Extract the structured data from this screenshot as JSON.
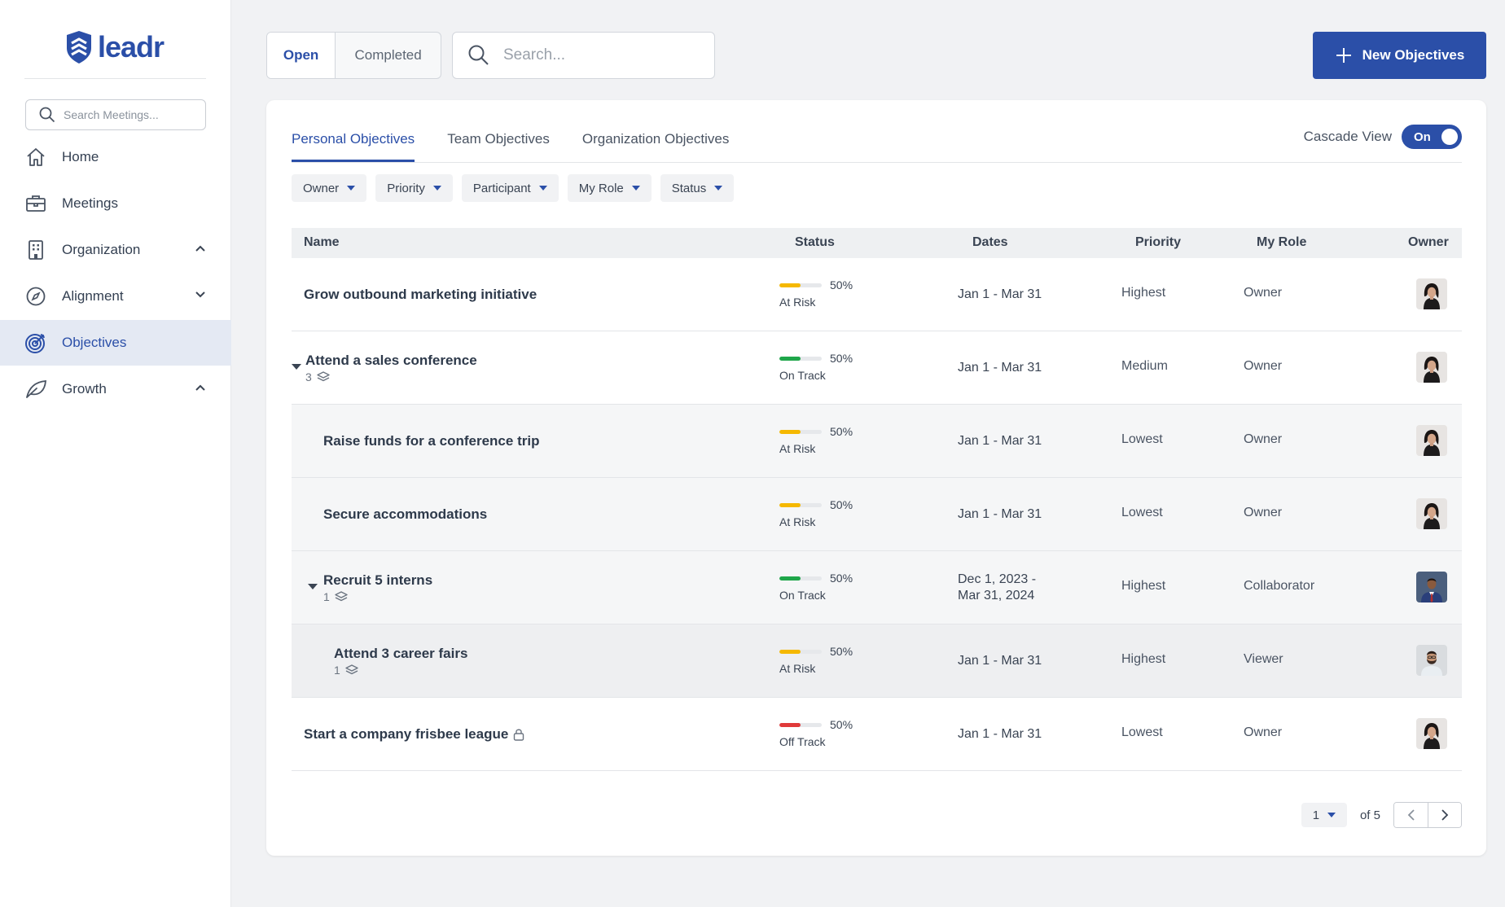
{
  "brand": {
    "name": "leadr",
    "color": "#2b4fa8"
  },
  "sidebar": {
    "search_placeholder": "Search Meetings...",
    "items": [
      {
        "label": "Home",
        "icon": "home-icon",
        "active": false
      },
      {
        "label": "Meetings",
        "icon": "briefcase-icon",
        "active": false
      },
      {
        "label": "Organization",
        "icon": "building-icon",
        "active": false,
        "chevron": "up"
      },
      {
        "label": "Alignment",
        "icon": "compass-icon",
        "active": false,
        "chevron": "down"
      },
      {
        "label": "Objectives",
        "icon": "target-icon",
        "active": true
      },
      {
        "label": "Growth",
        "icon": "leaf-icon",
        "active": false,
        "chevron": "up"
      }
    ]
  },
  "toolbar": {
    "segments": [
      "Open",
      "Completed"
    ],
    "active_segment": "Open",
    "search_placeholder": "Search...",
    "search_value": "",
    "new_button": "New Objectives"
  },
  "tabs": {
    "items": [
      "Personal Objectives",
      "Team Objectives",
      "Organization Objectives"
    ],
    "active": "Personal Objectives"
  },
  "cascade": {
    "label": "Cascade View",
    "state": "On"
  },
  "filters": [
    "Owner",
    "Priority",
    "Participant",
    "My Role",
    "Status"
  ],
  "table": {
    "columns": {
      "name": "Name",
      "status": "Status",
      "dates": "Dates",
      "priority": "Priority",
      "role": "My Role",
      "owner": "Owner"
    },
    "rows": [
      {
        "name": "Grow outbound marketing initiative",
        "level": 0,
        "percent": "50%",
        "progress": 0.5,
        "status": "At Risk",
        "status_color": "#f5b800",
        "dates": [
          "Jan 1 - Mar 31"
        ],
        "priority": "Highest",
        "role": "Owner",
        "avatar": "woman"
      },
      {
        "name": "Attend a sales conference",
        "level": 0,
        "expanded": true,
        "children_count": "3",
        "percent": "50%",
        "progress": 0.5,
        "status": "On Track",
        "status_color": "#1fa64a",
        "dates": [
          "Jan 1 - Mar 31"
        ],
        "priority": "Medium",
        "role": "Owner",
        "avatar": "woman"
      },
      {
        "name": "Raise funds for a conference trip",
        "level": 1,
        "percent": "50%",
        "progress": 0.5,
        "status": "At Risk",
        "status_color": "#f5b800",
        "dates": [
          "Jan 1 - Mar 31"
        ],
        "priority": "Lowest",
        "role": "Owner",
        "avatar": "woman"
      },
      {
        "name": "Secure accommodations",
        "level": 1,
        "percent": "50%",
        "progress": 0.5,
        "status": "At Risk",
        "status_color": "#f5b800",
        "dates": [
          "Jan 1 - Mar 31"
        ],
        "priority": "Lowest",
        "role": "Owner",
        "avatar": "woman"
      },
      {
        "name": "Recruit 5 interns",
        "level": 1,
        "expanded": true,
        "children_count": "1",
        "percent": "50%",
        "progress": 0.5,
        "status": "On Track",
        "status_color": "#1fa64a",
        "dates": [
          "Dec 1, 2023 -",
          "Mar 31, 2024"
        ],
        "priority": "Highest",
        "role": "Collaborator",
        "avatar": "man-suit"
      },
      {
        "name": "Attend 3 career fairs",
        "level": 2,
        "children_count": "1",
        "percent": "50%",
        "progress": 0.5,
        "status": "At Risk",
        "status_color": "#f5b800",
        "dates": [
          "Jan 1 - Mar 31"
        ],
        "priority": "Highest",
        "role": "Viewer",
        "avatar": "man-beard"
      },
      {
        "name": "Start a company frisbee league",
        "level": 0,
        "locked": true,
        "percent": "50%",
        "progress": 0.5,
        "status": "Off Track",
        "status_color": "#e03a3a",
        "dates": [
          "Jan 1 - Mar 31"
        ],
        "priority": "Lowest",
        "role": "Owner",
        "avatar": "woman"
      }
    ]
  },
  "pagination": {
    "current": "1",
    "of_label": "of 5"
  }
}
